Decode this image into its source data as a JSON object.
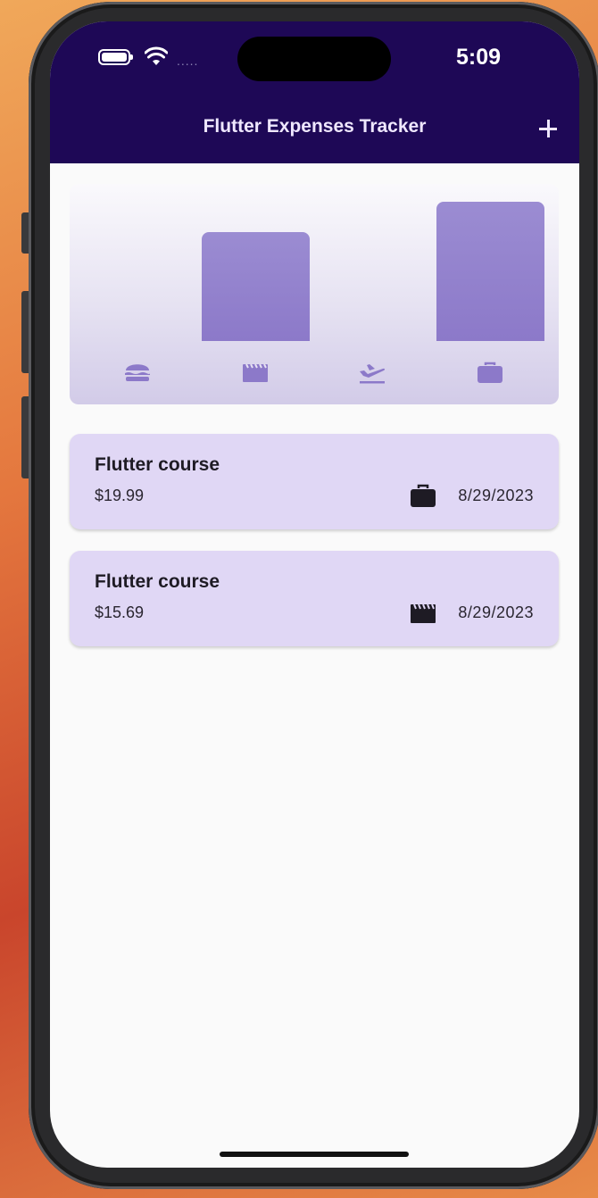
{
  "status_bar": {
    "time": "5:09",
    "signal_dots": "....."
  },
  "appbar": {
    "title": "Flutter Expenses Tracker",
    "add_icon": "plus-icon"
  },
  "colors": {
    "appbar_bg": "#1e0856",
    "bar_fill": "#9b8cd2",
    "card_bg": "#e0d7f5",
    "icon_tint": "#8c79c9"
  },
  "chart": {
    "categories": [
      {
        "icon": "food-icon",
        "relative_total": 0
      },
      {
        "icon": "leisure-icon",
        "relative_total": 0.785
      },
      {
        "icon": "travel-icon",
        "relative_total": 0
      },
      {
        "icon": "work-icon",
        "relative_total": 1
      }
    ]
  },
  "expenses": [
    {
      "title": "Flutter course",
      "amount": "$19.99",
      "category_icon": "work-icon",
      "date": "8/29/2023"
    },
    {
      "title": "Flutter course",
      "amount": "$15.69",
      "category_icon": "leisure-icon",
      "date": "8/29/2023"
    }
  ]
}
